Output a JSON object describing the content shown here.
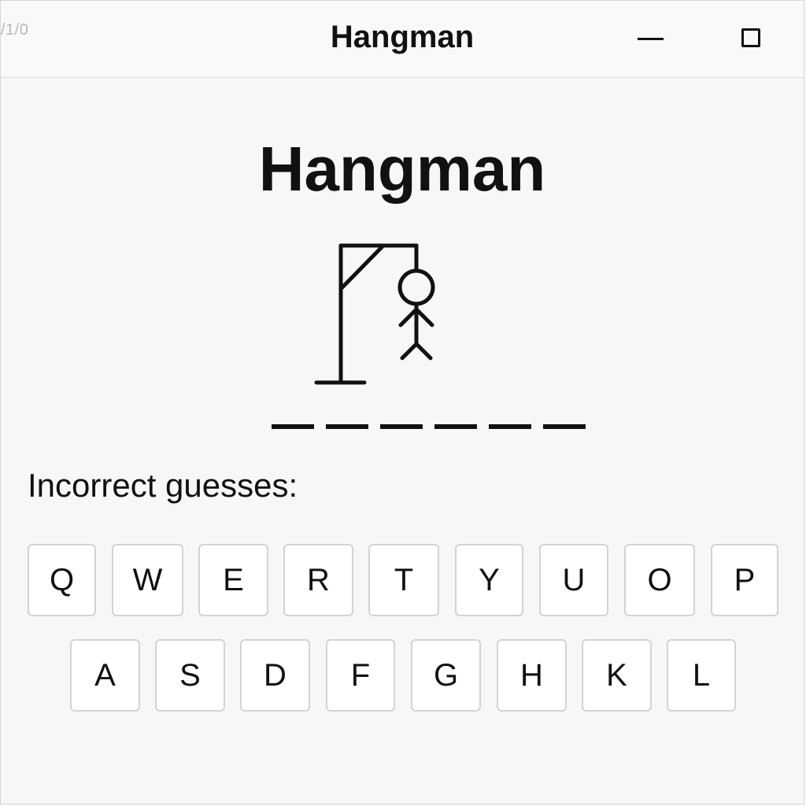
{
  "titlebar": {
    "corner_text": "/1/0",
    "title": "Hangman",
    "minimize_icon": "minimize-icon",
    "maximize_icon": "maximize-icon"
  },
  "game": {
    "heading": "Hangman",
    "word_blanks": 6,
    "incorrect_label": "Incorrect guesses:",
    "incorrect_value": ""
  },
  "keyboard": {
    "row1": [
      "Q",
      "W",
      "E",
      "R",
      "T",
      "Y",
      "U",
      "O",
      "P"
    ],
    "row2": [
      "A",
      "S",
      "D",
      "F",
      "G",
      "H",
      "K",
      "L"
    ]
  }
}
